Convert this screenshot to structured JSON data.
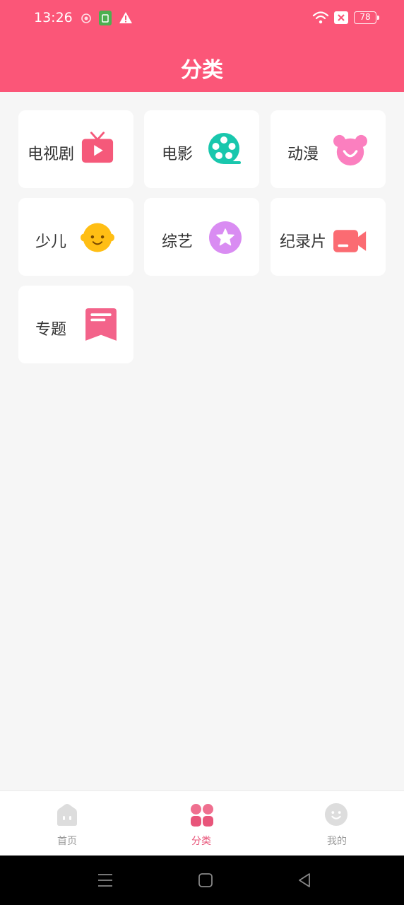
{
  "status_bar": {
    "time": "13:26",
    "battery": "78",
    "icons": [
      "location-icon",
      "sim-icon",
      "warning-icon",
      "wifi-icon",
      "no-signal-icon",
      "battery-icon"
    ]
  },
  "header": {
    "title": "分类"
  },
  "categories": [
    {
      "label": "电视剧",
      "icon": "tv-icon",
      "color": "#f5597a"
    },
    {
      "label": "电影",
      "icon": "film-reel-icon",
      "color": "#19c7ad"
    },
    {
      "label": "动漫",
      "icon": "bear-icon",
      "color": "#fb7fbf"
    },
    {
      "label": "少儿",
      "icon": "baby-face-icon",
      "color": "#ffbe14"
    },
    {
      "label": "综艺",
      "icon": "star-icon",
      "color": "#d98cf2"
    },
    {
      "label": "纪录片",
      "icon": "camera-icon",
      "color": "#fb6b72"
    },
    {
      "label": "专题",
      "icon": "bookmark-icon",
      "color": "#f3638a"
    }
  ],
  "tabbar": {
    "tabs": [
      {
        "label": "首页",
        "icon": "home-icon",
        "active": false
      },
      {
        "label": "分类",
        "icon": "category-grid-icon",
        "active": true
      },
      {
        "label": "我的",
        "icon": "profile-icon",
        "active": false
      }
    ],
    "active_color": "#e8557a",
    "inactive_color": "#999999"
  },
  "system_nav": [
    "menu-icon",
    "home-square-icon",
    "back-icon"
  ]
}
